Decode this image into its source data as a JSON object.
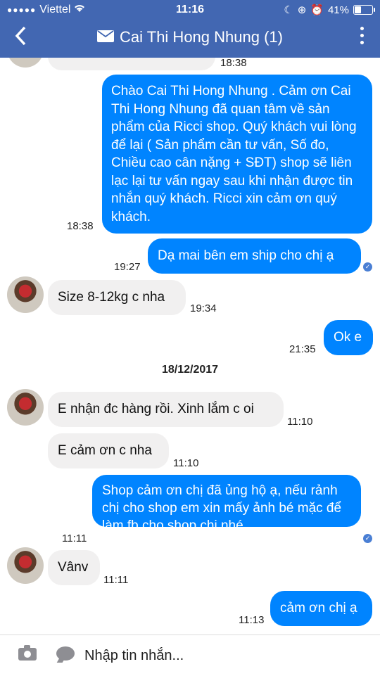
{
  "status_bar": {
    "signal_dots": "●●●●●",
    "carrier": "Viettel",
    "time": "11:16",
    "battery": "41%",
    "battery_level": 0.41
  },
  "nav": {
    "back_icon": "chevron-left-icon",
    "title": "Cai Thi Hong Nhung (1)",
    "title_icon": "envelope-icon",
    "menu_icon": "more-vertical-icon"
  },
  "messages": {
    "m0_time": "18:38",
    "m1_text": "Chào  Cai Thi Hong Nhung . Cảm ơn Cai Thi Hong Nhung đã quan tâm về sản phẩm của Ricci shop. Quý khách vui lòng để lại ( Sản phẩm cần tư vấn, Số đo, Chiều cao cân nặng + SĐT) shop sẽ liên lạc lại tư vấn ngay sau khi nhận được tin nhắn quý khách. Ricci xin cảm ơn quý khách.",
    "m1_time": "18:38",
    "m2_text": "Dạ mai bên em ship cho chị ạ",
    "m2_time": "19:27",
    "m3_text": "Size 8-12kg c nha",
    "m3_time": "19:34",
    "m4_text": "Ok e",
    "m4_time": "21:35",
    "date_separator": "18/12/2017",
    "m5_text": "E nhận đc hàng rồi. Xinh lắm c oi",
    "m5_time": "11:10",
    "m6_text": "E cảm ơn c nha",
    "m6_time": "11:10",
    "m7_text": "Shop cảm ơn chị đã ủng hộ ạ, nếu rảnh chị cho shop em xin mấy ảnh bé mặc để làm fb cho shop chị nhé",
    "m7_time": "11:11",
    "m8_text": "Vânv",
    "m8_time": "11:11",
    "m9_text": "cảm ơn chị ạ",
    "m9_time": "11:13"
  },
  "composer": {
    "placeholder": "Nhập tin nhắn...",
    "camera_icon": "camera-icon",
    "sticker_icon": "chat-bubble-icon"
  },
  "colors": {
    "header": "#4267b2",
    "outgoing_bubble": "#0084ff",
    "incoming_bubble": "#f1f0f0"
  }
}
